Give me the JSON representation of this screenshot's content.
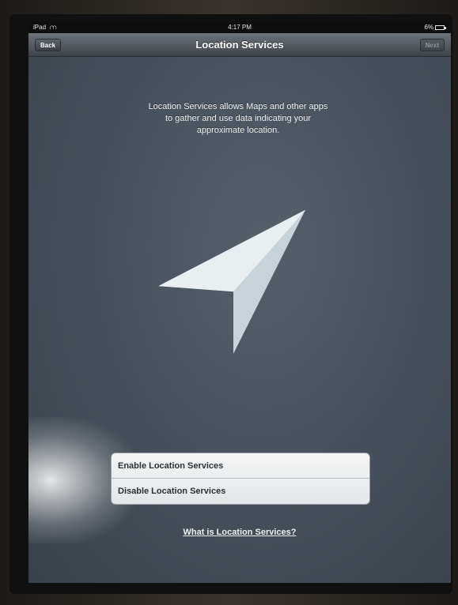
{
  "status_bar": {
    "device": "iPad",
    "time": "4:17 PM",
    "battery": "6%"
  },
  "nav": {
    "title": "Location Services",
    "back_label": "Back",
    "next_label": "Next"
  },
  "main": {
    "description": "Location Services allows Maps and other apps to gather and use data indicating your approximate location.",
    "icon": "location-arrow-icon"
  },
  "options": [
    {
      "label": "Enable Location Services"
    },
    {
      "label": "Disable Location Services"
    }
  ],
  "help_link": "What is Location Services?",
  "colors": {
    "background": "#48525c",
    "navbar": "#4a5057",
    "option_text": "#2c3035"
  }
}
